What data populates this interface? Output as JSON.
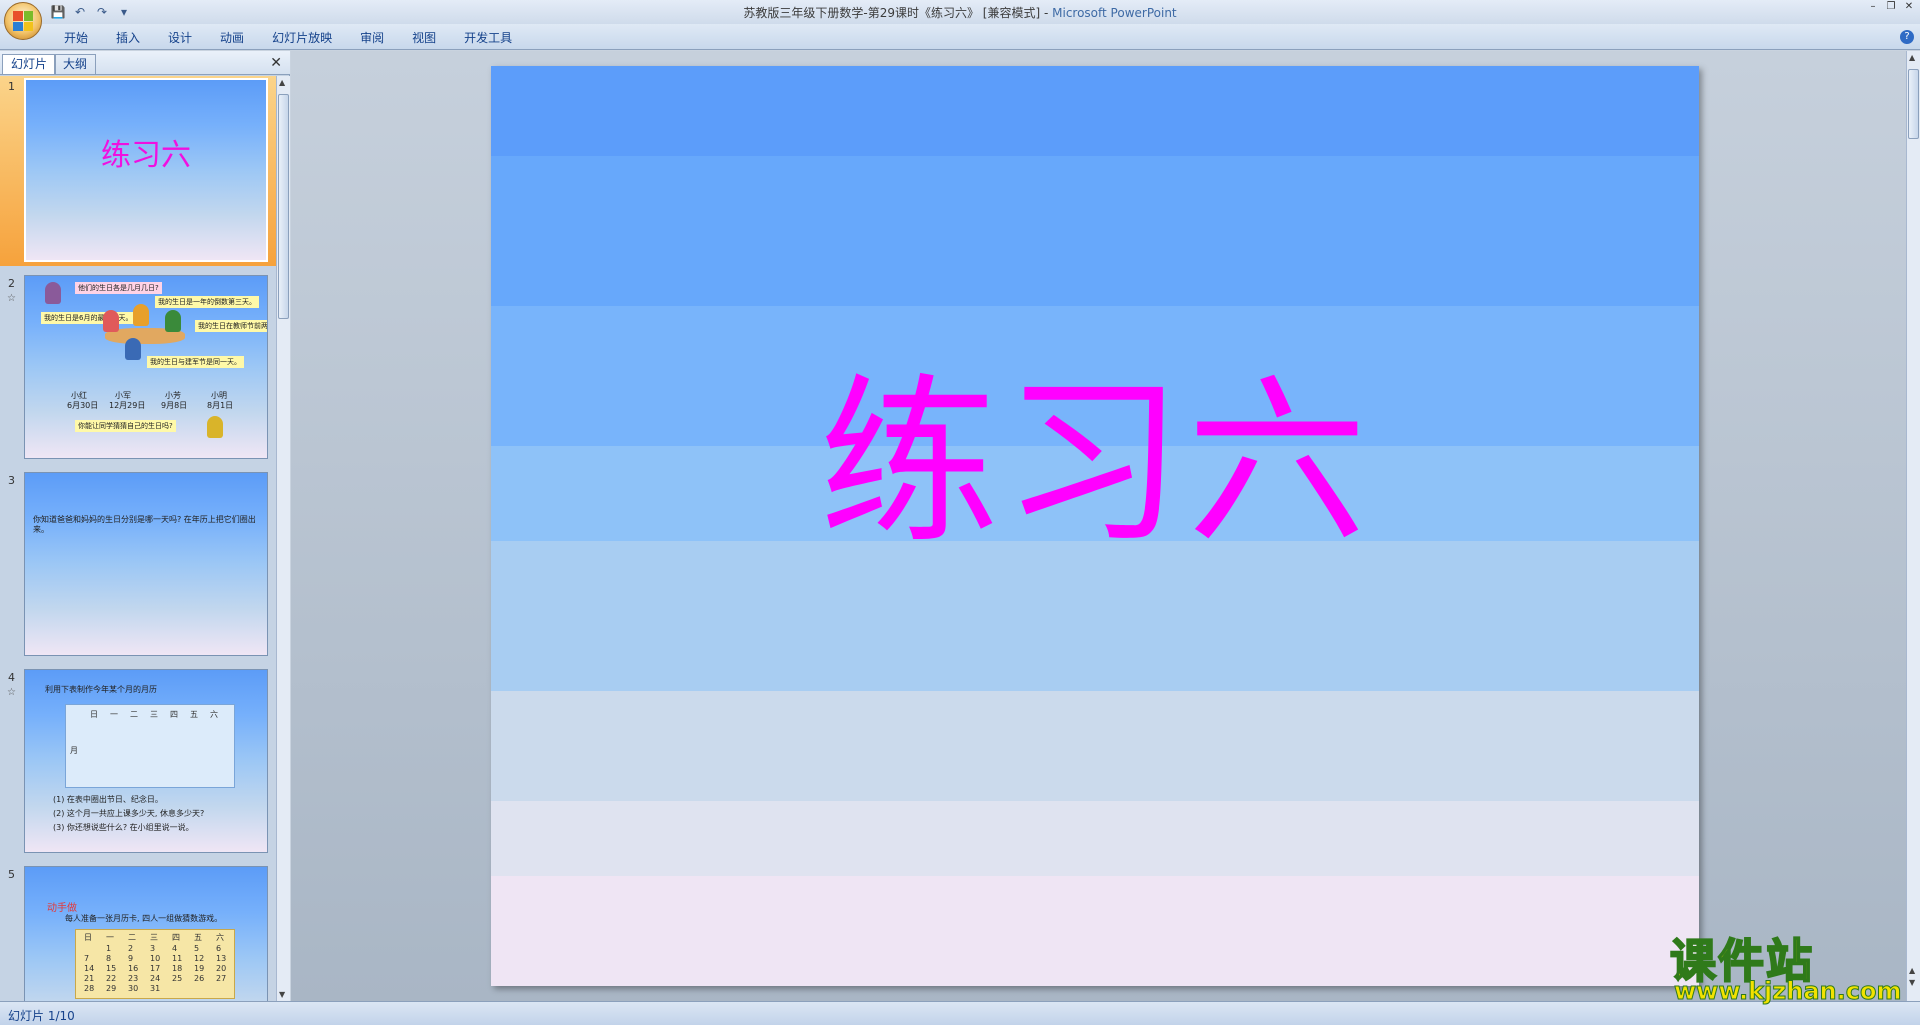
{
  "window": {
    "title_doc": "苏教版三年级下册数学-第29课时《练习六》 [兼容模式] - ",
    "title_app": "Microsoft PowerPoint"
  },
  "ribbon": {
    "tabs": [
      "开始",
      "插入",
      "设计",
      "动画",
      "幻灯片放映",
      "审阅",
      "视图",
      "开发工具"
    ]
  },
  "pane": {
    "tab_slides": "幻灯片",
    "tab_outline": "大纲"
  },
  "thumbnails": {
    "s1": {
      "num": "1",
      "title": "练习六"
    },
    "s2": {
      "num": "2",
      "q1": "他们的生日各是几月几日?",
      "b1": "我的生日是一年的倒数第三天。",
      "b2": "我的生日是6月的最后一天。",
      "b3": "我的生日在教师节前两天。",
      "b4": "我的生日与建军节是同一天。",
      "n1": "小红",
      "n2": "小军",
      "n3": "小芳",
      "n4": "小明",
      "d1": "6月30日",
      "d2": "12月29日",
      "d3": "9月8日",
      "d4": "8月1日",
      "q2": "你能让同学猜猜自己的生日吗?"
    },
    "s3": {
      "num": "3",
      "text": "你知道爸爸和妈妈的生日分别是哪一天吗? 在年历上把它们圈出来。"
    },
    "s4": {
      "num": "4",
      "head": "利用下表制作今年某个月的月历",
      "days": [
        "日",
        "一",
        "二",
        "三",
        "四",
        "五",
        "六"
      ],
      "month": "月",
      "l1": "(1) 在表中圈出节日、纪念日。",
      "l2": "(2) 这个月一共应上课多少天, 休息多少天?",
      "l3": "(3) 你还想说些什么? 在小组里说一说。"
    },
    "s5": {
      "num": "5",
      "game": "动手做",
      "text": "每人准备一张月历卡, 四人一组做猜数游戏。",
      "days": [
        "日",
        "一",
        "二",
        "三",
        "四",
        "五",
        "六"
      ],
      "r1": [
        "",
        "1",
        "2",
        "3",
        "4",
        "5",
        "6"
      ],
      "r2": [
        "7",
        "8",
        "9",
        "10",
        "11",
        "12",
        "13"
      ],
      "r3": [
        "14",
        "15",
        "16",
        "17",
        "18",
        "19",
        "20"
      ],
      "r4": [
        "21",
        "22",
        "23",
        "24",
        "25",
        "26",
        "27"
      ],
      "r5": [
        "28",
        "29",
        "30",
        "31",
        "",
        "",
        ""
      ]
    }
  },
  "slide": {
    "title": "练习六"
  },
  "status": {
    "text": "幻灯片 1/10"
  },
  "watermark": {
    "top": "课件站",
    "bottom": "www.kjzhan.com"
  }
}
